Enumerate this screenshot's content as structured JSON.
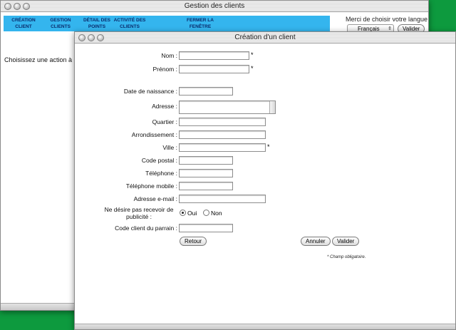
{
  "main_window": {
    "title": "Gestion des clients",
    "nav": [
      {
        "line1": "Création",
        "line2": "client"
      },
      {
        "line1": "Gestion",
        "line2": "clients"
      },
      {
        "line1": "Détail des",
        "line2": "points"
      },
      {
        "line1": "Activité des",
        "line2": "clients"
      },
      {
        "line1": "Fermer la",
        "line2": "fenêtre"
      }
    ],
    "language_label": "Merci de choisir votre langue",
    "language_selected": "Français",
    "language_submit": "Valider",
    "message": "Choisissez une action à r"
  },
  "dialog": {
    "title": "Création d'un client",
    "fields": {
      "nom": "Nom :",
      "prenom": "Prénom :",
      "naissance": "Date de naissance :",
      "adresse": "Adresse :",
      "quartier": "Quartier :",
      "arrondissement": "Arrondissement :",
      "ville": "Ville :",
      "code_postal": "Code postal :",
      "telephone": "Téléphone :",
      "mobile": "Téléphone mobile :",
      "email": "Adresse e-mail :",
      "pub_line1": "Ne désire pas recevoir de",
      "pub_line2": "publicité :",
      "parrain": "Code client du parrain :"
    },
    "required_mark": "*",
    "radio_yes": "Oui",
    "radio_no": "Non",
    "buttons": {
      "back": "Retour",
      "cancel": "Annuler",
      "submit": "Valider"
    },
    "required_note": "* Champ obligatoire."
  }
}
